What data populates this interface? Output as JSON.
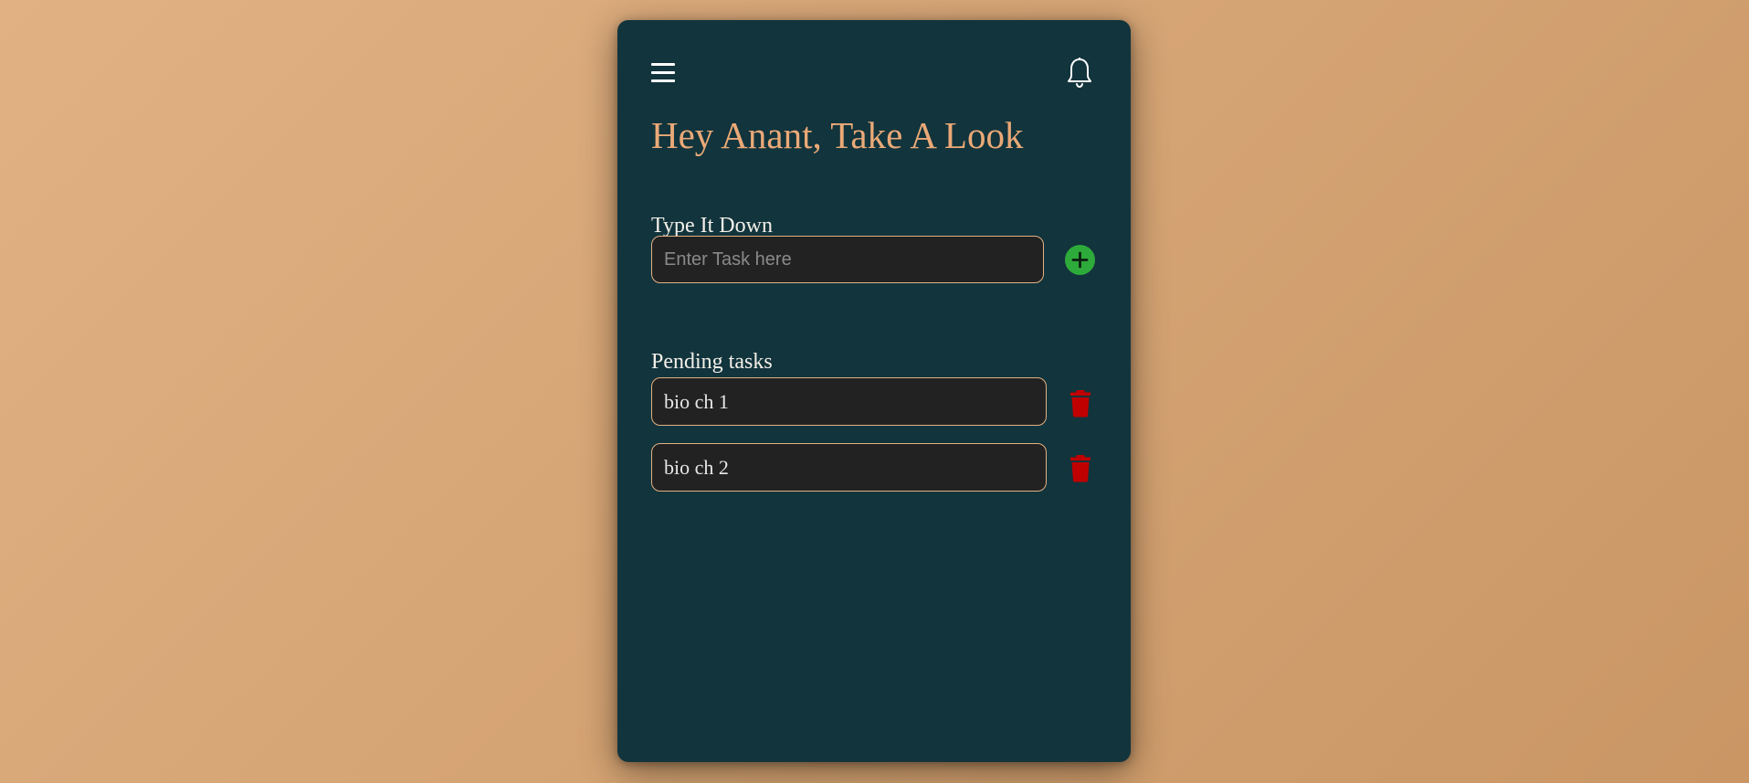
{
  "header": {
    "menu_icon": "hamburger-menu-icon",
    "bell_icon": "bell-icon",
    "title": "Hey Anant, Take A Look"
  },
  "new_task": {
    "label": "Type It Down",
    "placeholder": "Enter Task here",
    "value": "",
    "add_icon": "plus-circle-icon"
  },
  "pending": {
    "label": "Pending tasks",
    "items": [
      {
        "text": "bio ch 1",
        "delete_icon": "trash-icon"
      },
      {
        "text": "bio ch 2",
        "delete_icon": "trash-icon"
      }
    ]
  },
  "colors": {
    "background": "#d5a474",
    "card": "#12343c",
    "title": "#eaa977",
    "input_border": "#e1b184",
    "add_button": "#2eaa3a",
    "delete": "#c00000"
  }
}
